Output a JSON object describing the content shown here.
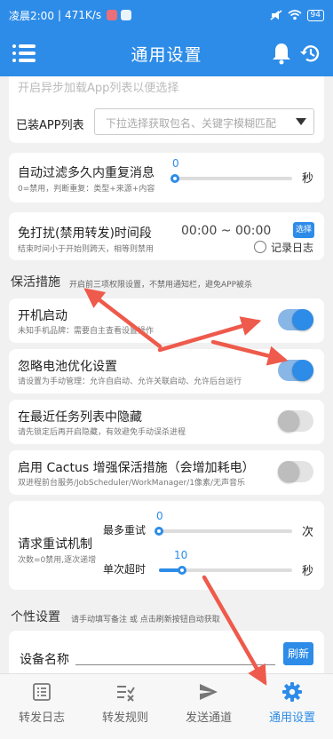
{
  "status_bar": {
    "time": "凌晨2:00",
    "speed": "471K/s",
    "battery": "94"
  },
  "toolbar": {
    "title": "通用设置"
  },
  "top_hint": "开启异步加载App列表以便选择",
  "app_list": {
    "label": "已装APP列表",
    "placeholder": "下拉选择获取包名、关键字模糊匹配"
  },
  "dedup": {
    "label": "自动过滤多久内重复消息",
    "sub": "0=禁用，判断重复：类型+来源+内容",
    "value": "0",
    "unit": "秒"
  },
  "dnd": {
    "label": "免打扰(禁用转发)时间段",
    "sub": "结束时间小于开始则跨天，相等则禁用",
    "time_range": "00:00 ~ 00:00",
    "select_label": "选择",
    "record_log_label": "记录日志"
  },
  "keepalive": {
    "title": "保活措施",
    "sub": "开启前三项权限设置，不禁用通知栏，避免APP被杀"
  },
  "autostart": {
    "label": "开机启动",
    "sub": "未知手机品牌：需要自主查看设置操作",
    "enabled": true
  },
  "battery_opt": {
    "label": "忽略电池优化设置",
    "sub": "请设置为手动管理：允许自启动、允许关联启动、允许后台运行",
    "enabled": true
  },
  "hide_recent": {
    "label": "在最近任务列表中隐藏",
    "sub": "请先锁定后再开启隐藏，有效避免手动误杀进程",
    "enabled": false
  },
  "cactus": {
    "label": "启用 Cactus 增强保活措施（会增加耗电）",
    "sub": "双进程前台服务/JobScheduler/WorkManager/1像素/无声音乐",
    "enabled": false
  },
  "retry": {
    "label": "请求重试机制",
    "sub": "次数=0禁用,逐次递增",
    "max_label": "最多重试",
    "max_value": "0",
    "max_unit": "次",
    "max_fraction": 0,
    "timeout_label": "单次超时",
    "timeout_value": "10",
    "timeout_unit": "秒",
    "timeout_fraction": 0.17
  },
  "personal": {
    "title": "个性设置",
    "sub": "请手动填写备注 或 点击刷新按钮自动获取",
    "device_name_label": "设备名称",
    "refresh_label": "刷新"
  },
  "nav": [
    {
      "label": "转发日志",
      "icon": "list-icon"
    },
    {
      "label": "转发规则",
      "icon": "rules-icon"
    },
    {
      "label": "发送通道",
      "icon": "send-icon"
    },
    {
      "label": "通用设置",
      "icon": "gear-icon",
      "active": true
    }
  ],
  "colors": {
    "primary": "#2d8ce8",
    "annotation_arrow": "#ee5a4b"
  }
}
